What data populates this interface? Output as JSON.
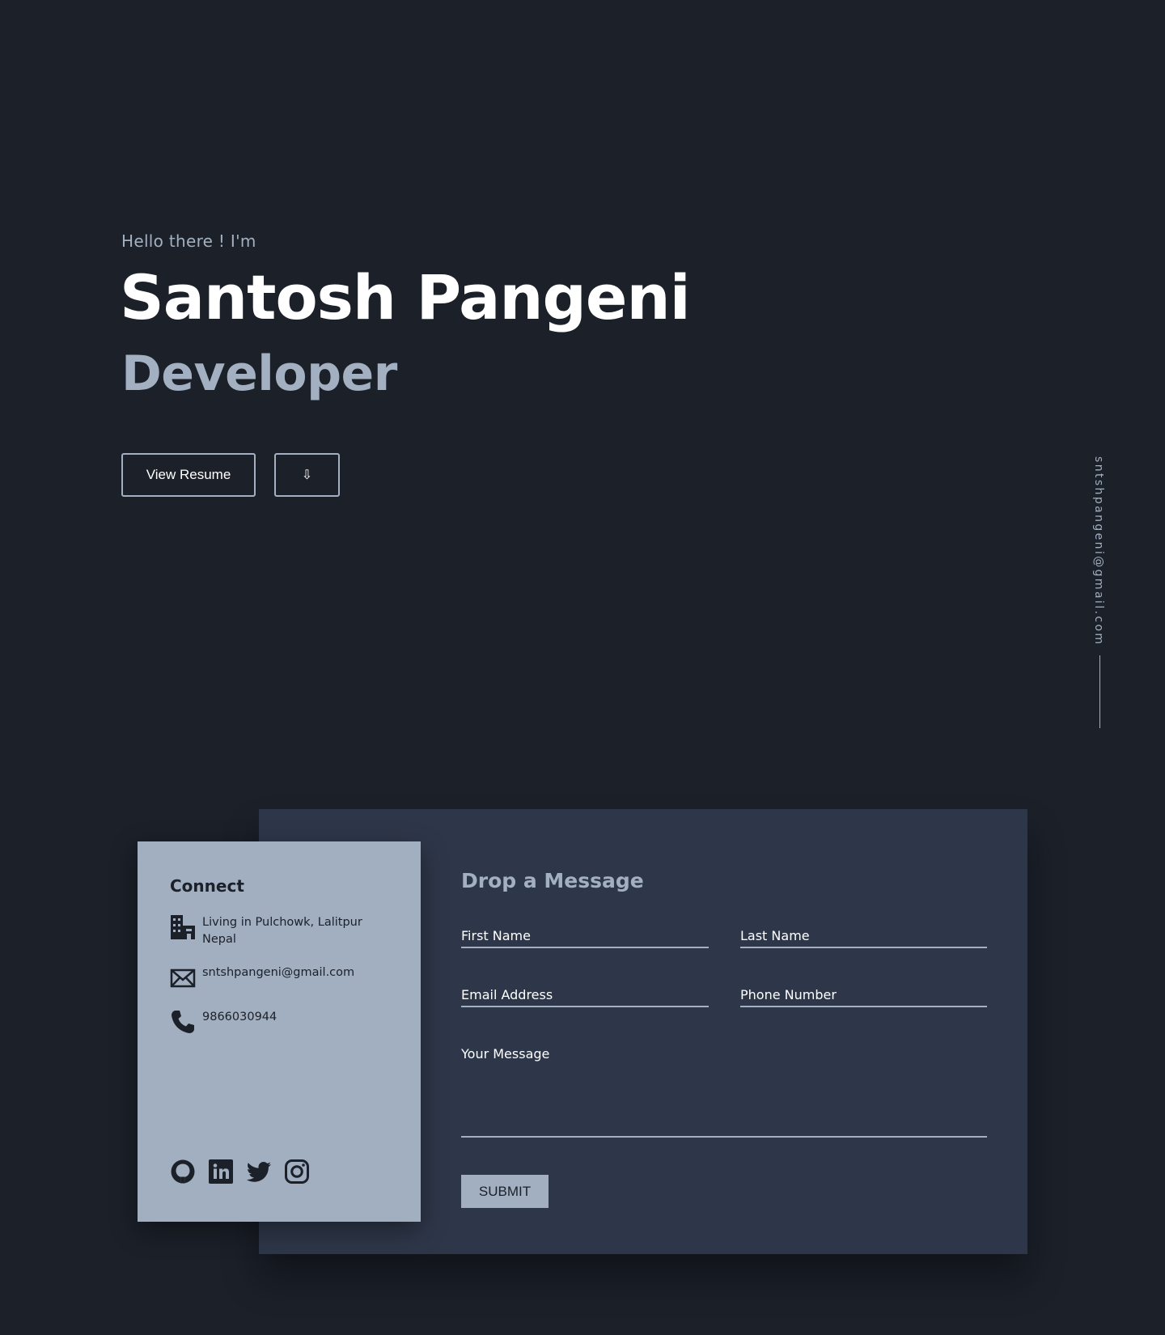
{
  "hero": {
    "greeting": "Hello there ! I'm",
    "name": "Santosh Pangeni",
    "role": "Developer",
    "resume_button": "View Resume",
    "download_button": "⇩"
  },
  "side_rail": {
    "email": "sntshpangeni@gmail.com"
  },
  "connect": {
    "title": "Connect",
    "address_line1": "Living in Pulchowk, Lalitpur",
    "address_line2": "Nepal",
    "email": "sntshpangeni@gmail.com",
    "phone": "9866030944",
    "icons": {
      "address": "building-icon",
      "email": "envelope-icon",
      "phone": "phone-icon"
    },
    "social": [
      "github-icon",
      "linkedin-icon",
      "twitter-icon",
      "instagram-icon"
    ]
  },
  "form": {
    "title": "Drop a Message",
    "first_name": "First Name",
    "last_name": "Last Name",
    "email": "Email Address",
    "phone": "Phone Number",
    "message": "Your Message",
    "submit": "SUBMIT"
  },
  "colors": {
    "background": "#1b2029",
    "panel": "#2e3749",
    "accent": "#a3b0c1",
    "text": "#ffffff"
  }
}
